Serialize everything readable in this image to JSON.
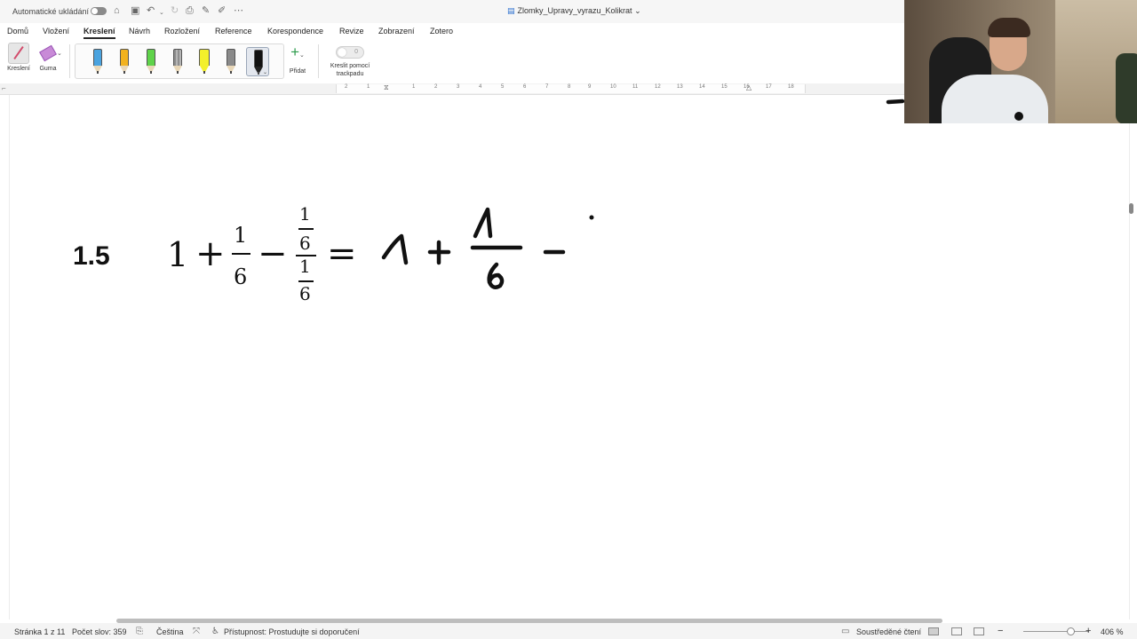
{
  "titlebar": {
    "autosave_label": "Automatické ukládání",
    "document_title": "Zlomky_Upravy_vyrazu_Kolikrat"
  },
  "ribbon": {
    "tabs": [
      "Domů",
      "Vložení",
      "Kreslení",
      "Návrh",
      "Rozložení",
      "Reference",
      "Korespondence",
      "Revize",
      "Zobrazení",
      "Zotero"
    ],
    "active_tab": "Kreslení",
    "draw_label": "Kreslení",
    "eraser_label": "Guma",
    "add_label": "Přidat",
    "trackpad_label_line1": "Kreslit pomocí",
    "trackpad_label_line2": "trackpadu",
    "pens": [
      {
        "name": "pen-blue",
        "color": "#4aa3df"
      },
      {
        "name": "pen-orange",
        "color": "#f2b21e"
      },
      {
        "name": "pen-green",
        "color": "#5fd34a"
      },
      {
        "name": "pencil-gray",
        "color": "#8d8d8d"
      },
      {
        "name": "highlighter-yellow",
        "color": "#f3f02b"
      },
      {
        "name": "pen-gray",
        "color": "#8a8a8a"
      },
      {
        "name": "pen-black",
        "color": "#111111"
      }
    ],
    "selected_pen": "pen-black"
  },
  "ruler": {
    "numbers": [
      "2",
      "1",
      "1",
      "2",
      "3",
      "4",
      "5",
      "6",
      "7",
      "8",
      "9",
      "10",
      "11",
      "12",
      "13",
      "14",
      "15",
      "16",
      "17",
      "18"
    ]
  },
  "document": {
    "exercise_number": "1.5",
    "typed_expression": {
      "integer": "1",
      "plus": "+",
      "frac_num": "1",
      "frac_den": "6",
      "minus": "−",
      "complex_num_num": "1",
      "complex_num_den": "6",
      "complex_den_num": "1",
      "complex_den_den": "6",
      "equals": "="
    },
    "ink_color": "#111111"
  },
  "statusbar": {
    "page": "Stránka 1 z 11",
    "word_count": "Počet slov: 359",
    "language": "Čeština",
    "accessibility": "Přístupnost: Prostudujte si doporučení",
    "focus_mode": "Soustředěné čtení",
    "zoom": "406 %",
    "zoom_minus": "−",
    "zoom_plus": "+"
  }
}
